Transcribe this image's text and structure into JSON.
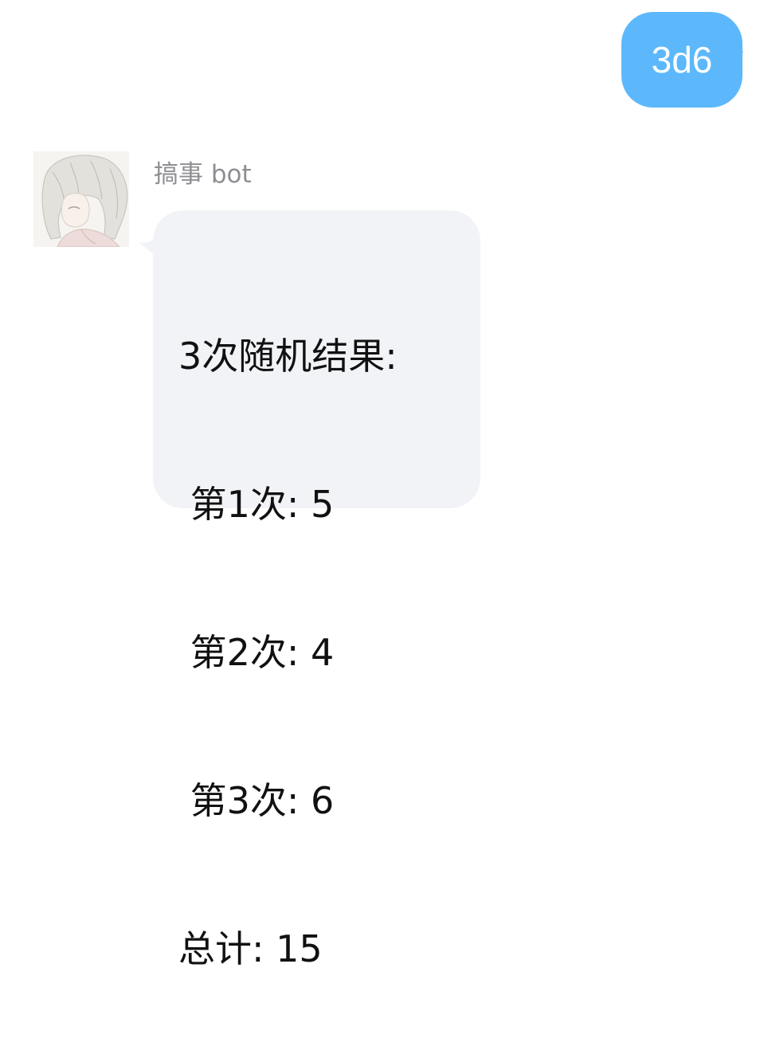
{
  "outgoing": {
    "text": "3d6",
    "color": "#5cb8fb"
  },
  "incoming": {
    "sender": "搞事 bot",
    "avatar_icon": "anime-girl-avatar",
    "bubble_color": "#f2f3f7",
    "lines": [
      "3次随机结果:",
      " 第1次: 5",
      " 第2次: 4",
      " 第3次: 6",
      "总计: 15"
    ]
  }
}
